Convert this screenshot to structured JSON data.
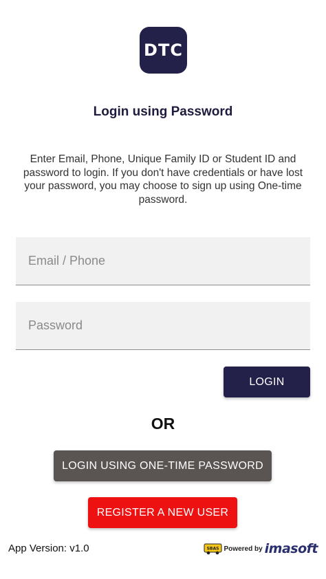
{
  "logo": {
    "text": "DTC"
  },
  "title": "Login using Password",
  "description": "Enter Email, Phone, Unique Family ID or Student ID and password to login. If you don't have credentials or have lost your password, you may choose to sign up using One-time password.",
  "form": {
    "email_placeholder": "Email / Phone",
    "password_placeholder": "Password"
  },
  "buttons": {
    "login": "LOGIN",
    "otp": "LOGIN USING ONE-TIME PASSWORD",
    "register": "REGISTER A NEW USER"
  },
  "separator": "OR",
  "footer": {
    "version": "App Version: v1.0",
    "bus_label": "SBAS",
    "powered_by": "Powered by",
    "brand": "imasoft"
  },
  "colors": {
    "primary": "#23204a",
    "otp_button": "#5a5452",
    "register_button": "#ee1111",
    "bus_yellow": "#f5c518"
  }
}
